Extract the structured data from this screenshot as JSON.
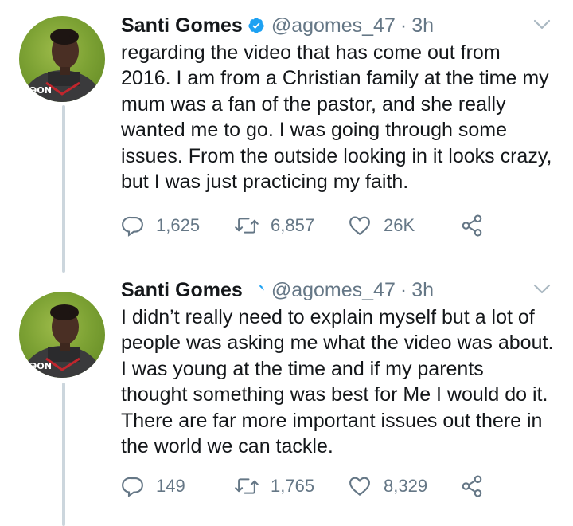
{
  "tweets": [
    {
      "author_name": "Santi Gomes",
      "handle": "@agomes_47",
      "separator": "·",
      "time": "3h",
      "avatar_badge": "ƏON",
      "text_lines": [
        "regarding the video that has come out from",
        "2016. I am from a Christian family at the time my",
        "mum was a fan of the pastor, and she really",
        "wanted me to go. I was going through some",
        "issues. From the outside looking in it looks crazy,",
        "but I was just practicing my faith."
      ],
      "replies": "1,625",
      "retweets": "6,857",
      "likes": "26K"
    },
    {
      "author_name": "Santi Gomes",
      "handle": "@agomes_47",
      "separator": "·",
      "time": "3h",
      "avatar_badge": "ƏON",
      "text_lines": [
        "I didn’t really need to explain myself but a lot of",
        "people was asking me what the video was about.",
        "I was young at the time and if my parents",
        "thought something was best for Me I would do it.",
        "There are far more important issues out there in",
        "the world we can tackle."
      ],
      "replies": "149",
      "retweets": "1,765",
      "likes": "8,329"
    }
  ],
  "icons": {
    "verified": "verified-badge-icon",
    "caret": "chevron-down-icon",
    "reply": "reply-icon",
    "retweet": "retweet-icon",
    "like": "heart-icon",
    "share": "share-icon"
  },
  "colors": {
    "verified_blue": "#1da1f2",
    "secondary_text": "#657786",
    "thread_line": "#ccd6dd",
    "avatar_background": "#7da234"
  }
}
